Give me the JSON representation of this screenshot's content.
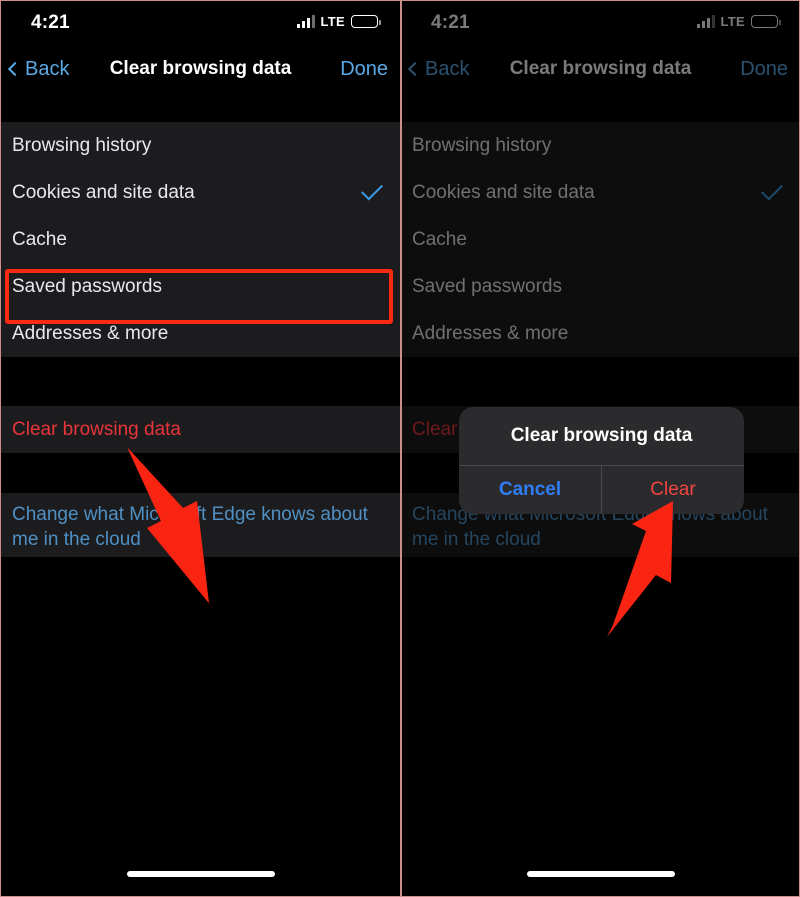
{
  "screen": {
    "status_bar": {
      "time": "4:21",
      "carrier_label": "LTE",
      "signal_icon": "signal-bars-icon",
      "battery_icon": "battery-icon"
    },
    "nav_bar": {
      "back_label": "Back",
      "back_icon": "chevron-left-icon",
      "title": "Clear browsing data",
      "done_label": "Done"
    },
    "options": [
      {
        "label": "Browsing history",
        "selected": false
      },
      {
        "label": "Cookies and site data",
        "selected": true
      },
      {
        "label": "Cache",
        "selected": false
      },
      {
        "label": "Saved passwords",
        "selected": false
      },
      {
        "label": "Addresses & more",
        "selected": false
      }
    ],
    "clear_action": {
      "label": "Clear browsing data"
    },
    "cloud_link": {
      "label": "Change what Microsoft Edge knows about me in the cloud"
    },
    "checkmark_icon": "checkmark-icon"
  },
  "dialog": {
    "title": "Clear browsing data",
    "cancel_label": "Cancel",
    "confirm_label": "Clear"
  },
  "annotations": {
    "left_arrow_name": "arrow-pointing-to-clear-browsing-data",
    "right_arrow_name": "arrow-pointing-to-clear-button",
    "highlight_name": "highlight-box-cookies-and-site-data"
  },
  "colors": {
    "accent_blue": "#5aa9e6",
    "destructive_red": "#e8353a",
    "link_blue": "#4f90c4",
    "annotation_red": "#fa2a12",
    "dialog_confirm_red": "#f2443f",
    "dialog_cancel_blue": "#2f7cf6",
    "row_background": "#1c1c1e",
    "screen_background": "#000000"
  }
}
